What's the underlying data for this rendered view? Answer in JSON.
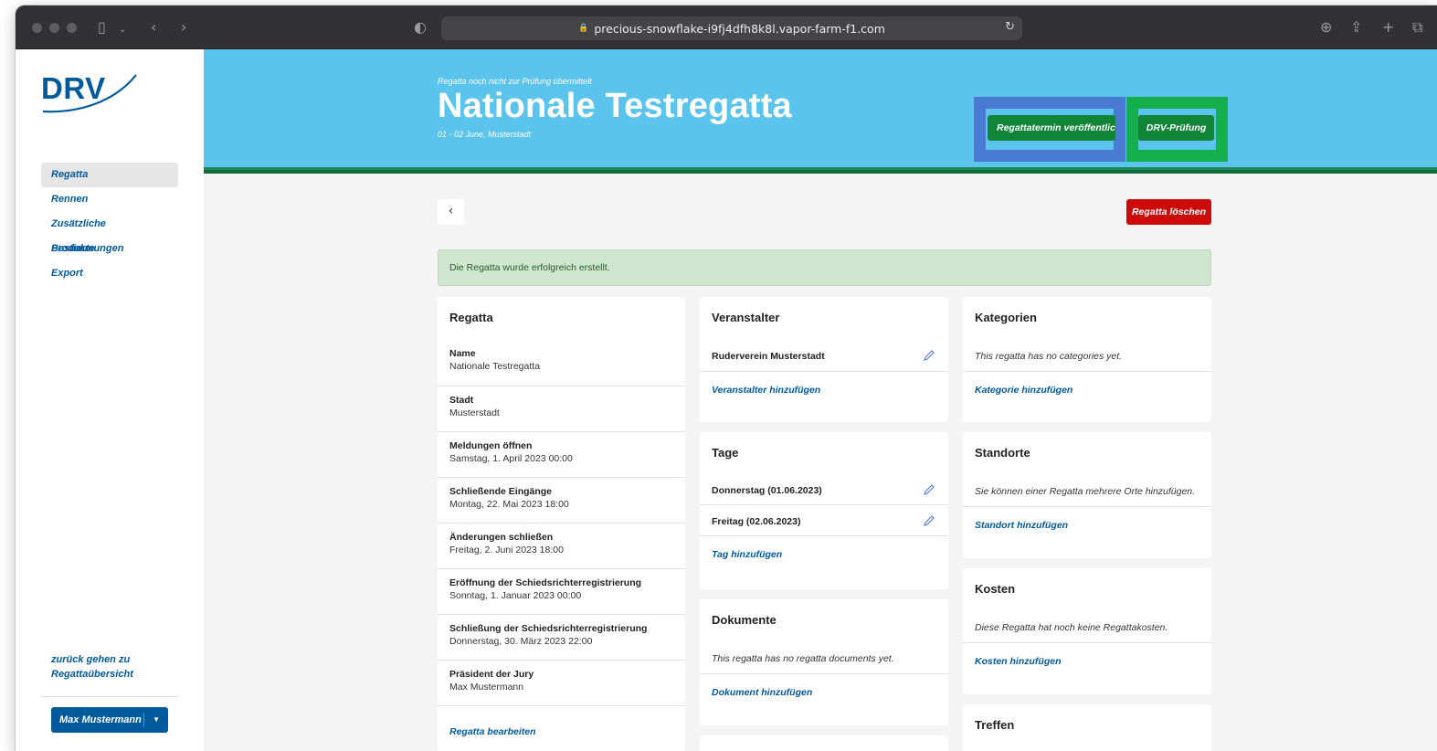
{
  "browser": {
    "url": "precious-snowflake-i9fj4dfh8k8l.vapor-farm-f1.com"
  },
  "sidebar": {
    "logo": "DRV",
    "items": [
      {
        "label": "Regatta"
      },
      {
        "label": "Rennen"
      },
      {
        "label": "Zusätzliche Bestimmungen"
      },
      {
        "label": "Produkte"
      },
      {
        "label": "Export"
      }
    ],
    "back_link": "zurück gehen zu Regattaübersicht",
    "user": "Max Mustermann"
  },
  "header": {
    "status": "Regatta noch nicht zur Prüfung übermittelt",
    "title": "Nationale Testregatta",
    "date_place": "01 - 02 June,  Musterstadt",
    "publish_button": "Regattatermin veröffentlichen",
    "review_button": "DRV-Prüfung",
    "colors": {
      "hero": "#5bc4ec",
      "button": "#108538",
      "highlight_blue": "#4a7ad2",
      "highlight_green": "#14b04e"
    }
  },
  "toolbar": {
    "delete_button": "Regatta löschen"
  },
  "alert": {
    "message": "Die Regatta wurde erfolgreich erstellt."
  },
  "regatta_card": {
    "title": "Regatta",
    "fields": [
      {
        "label": "Name",
        "value": "Nationale Testregatta"
      },
      {
        "label": "Stadt",
        "value": "Musterstadt"
      },
      {
        "label": "Meldungen öffnen",
        "value": "Samstag, 1. April 2023 00:00"
      },
      {
        "label": "Schließende Eingänge",
        "value": "Montag, 22. Mai 2023 18:00"
      },
      {
        "label": "Änderungen schließen",
        "value": "Freitag, 2. Juni 2023 18:00"
      },
      {
        "label": "Eröffnung der Schiedsrichterregistrierung",
        "value": "Sonntag, 1. Januar 2023 00:00"
      },
      {
        "label": "Schließung der Schiedsrichterregistrierung",
        "value": "Donnerstag, 30. März 2023 22:00"
      },
      {
        "label": "Präsident der Jury",
        "value": "Max Mustermann"
      }
    ],
    "edit_link": "Regatta bearbeiten"
  },
  "veranstalter_card": {
    "title": "Veranstalter",
    "item": "Ruderverein Musterstadt",
    "add_link": "Veranstalter hinzufügen"
  },
  "tage_card": {
    "title": "Tage",
    "items": [
      "Donnerstag (01.06.2023)",
      "Freitag (02.06.2023)"
    ],
    "add_link": "Tag hinzufügen"
  },
  "dokumente_card": {
    "title": "Dokumente",
    "empty": "This regatta has no regatta documents yet.",
    "add_link": "Dokument hinzufügen"
  },
  "kategorien_card": {
    "title": "Kategorien",
    "empty": "This regatta has no categories yet.",
    "add_link": "Kategorie hinzufügen"
  },
  "standorte_card": {
    "title": "Standorte",
    "empty": "Sie können einer Regatta mehrere Orte hinzufügen.",
    "add_link": "Standort hinzufügen"
  },
  "kosten_card": {
    "title": "Kosten",
    "empty": "Diese Regatta hat noch keine Regattakosten.",
    "add_link": "Kosten hinzufügen"
  },
  "treffen_card": {
    "title": "Treffen"
  }
}
